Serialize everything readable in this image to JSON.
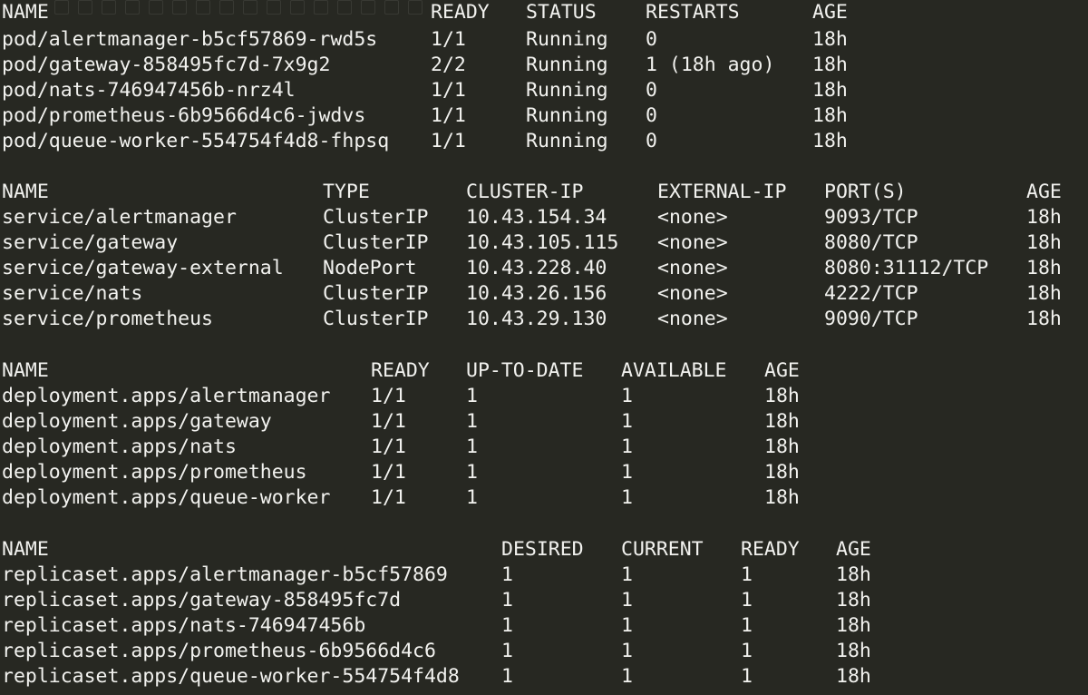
{
  "pods": {
    "headers": [
      "NAME",
      "READY",
      "STATUS",
      "RESTARTS",
      "AGE"
    ],
    "rows": [
      [
        "pod/alertmanager-b5cf57869-rwd5s",
        "1/1",
        "Running",
        "0",
        "18h"
      ],
      [
        "pod/gateway-858495fc7d-7x9g2",
        "2/2",
        "Running",
        "1 (18h ago)",
        "18h"
      ],
      [
        "pod/nats-746947456b-nrz4l",
        "1/1",
        "Running",
        "0",
        "18h"
      ],
      [
        "pod/prometheus-6b9566d4c6-jwdvs",
        "1/1",
        "Running",
        "0",
        "18h"
      ],
      [
        "pod/queue-worker-554754f4d8-fhpsq",
        "1/1",
        "Running",
        "0",
        "18h"
      ]
    ]
  },
  "services": {
    "headers": [
      "NAME",
      "TYPE",
      "CLUSTER-IP",
      "EXTERNAL-IP",
      "PORT(S)",
      "AGE"
    ],
    "rows": [
      [
        "service/alertmanager",
        "ClusterIP",
        "10.43.154.34",
        "<none>",
        "9093/TCP",
        "18h"
      ],
      [
        "service/gateway",
        "ClusterIP",
        "10.43.105.115",
        "<none>",
        "8080/TCP",
        "18h"
      ],
      [
        "service/gateway-external",
        "NodePort",
        "10.43.228.40",
        "<none>",
        "8080:31112/TCP",
        "18h"
      ],
      [
        "service/nats",
        "ClusterIP",
        "10.43.26.156",
        "<none>",
        "4222/TCP",
        "18h"
      ],
      [
        "service/prometheus",
        "ClusterIP",
        "10.43.29.130",
        "<none>",
        "9090/TCP",
        "18h"
      ]
    ]
  },
  "deployments": {
    "headers": [
      "NAME",
      "READY",
      "UP-TO-DATE",
      "AVAILABLE",
      "AGE"
    ],
    "rows": [
      [
        "deployment.apps/alertmanager",
        "1/1",
        "1",
        "1",
        "18h"
      ],
      [
        "deployment.apps/gateway",
        "1/1",
        "1",
        "1",
        "18h"
      ],
      [
        "deployment.apps/nats",
        "1/1",
        "1",
        "1",
        "18h"
      ],
      [
        "deployment.apps/prometheus",
        "1/1",
        "1",
        "1",
        "18h"
      ],
      [
        "deployment.apps/queue-worker",
        "1/1",
        "1",
        "1",
        "18h"
      ]
    ]
  },
  "replicasets": {
    "headers": [
      "NAME",
      "DESIRED",
      "CURRENT",
      "READY",
      "AGE"
    ],
    "rows": [
      [
        "replicaset.apps/alertmanager-b5cf57869",
        "1",
        "1",
        "1",
        "18h"
      ],
      [
        "replicaset.apps/gateway-858495fc7d",
        "1",
        "1",
        "1",
        "18h"
      ],
      [
        "replicaset.apps/nats-746947456b",
        "1",
        "1",
        "1",
        "18h"
      ],
      [
        "replicaset.apps/prometheus-6b9566d4c6",
        "1",
        "1",
        "1",
        "18h"
      ],
      [
        "replicaset.apps/queue-worker-554754f4d8",
        "1",
        "1",
        "1",
        "18h"
      ]
    ]
  },
  "colors": {
    "background": "#272822",
    "foreground": "#f2f2ef",
    "ghost": "#3c3d37"
  }
}
